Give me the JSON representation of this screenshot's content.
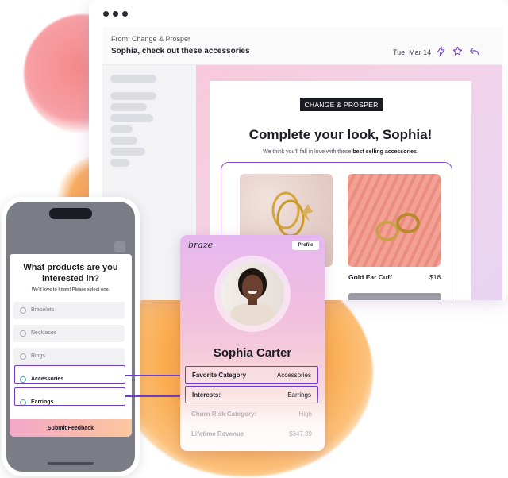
{
  "email": {
    "from": "From: Change & Prosper",
    "subject": "Sophia, check out these accessories",
    "date": "Tue, Mar 14",
    "brand": "CHANGE & PROSPER",
    "headline": "Complete your look, Sophia!",
    "subline_pre": "We think you'll fall in love with these ",
    "subline_bold": "best selling accessories",
    "subline_post": ".",
    "product": {
      "name": "Gold Ear Cuff",
      "price": "$18"
    }
  },
  "survey": {
    "title": "What products are you interested in?",
    "subtitle": "We'd love to know! Please select one.",
    "options": [
      {
        "label": "Bracelets",
        "selected": false
      },
      {
        "label": "Necklaces",
        "selected": false
      },
      {
        "label": "Rings",
        "selected": false
      },
      {
        "label": "Accessories",
        "selected": true
      },
      {
        "label": "Earrings",
        "selected": true
      }
    ],
    "submit_label": "Submit Feedback"
  },
  "profile": {
    "logo": "braze",
    "button_label": "Profile",
    "name": "Sophia Carter",
    "rows": [
      {
        "key": "Favorite Category",
        "value": "Accessories",
        "highlighted": true
      },
      {
        "key": "Interests:",
        "value": "Earrings",
        "highlighted": true
      },
      {
        "key": "Churn Risk Category:",
        "value": "High",
        "highlighted": false
      },
      {
        "key": "Lifetime Revenue",
        "value": "$347.89",
        "highlighted": false
      }
    ]
  },
  "colors": {
    "accent_purple": "#6a3fc4",
    "brand_orange": "#f9a13d",
    "brand_pink": "#f58a8a"
  },
  "icons": [
    "lightning-icon",
    "star-icon",
    "reply-icon"
  ]
}
